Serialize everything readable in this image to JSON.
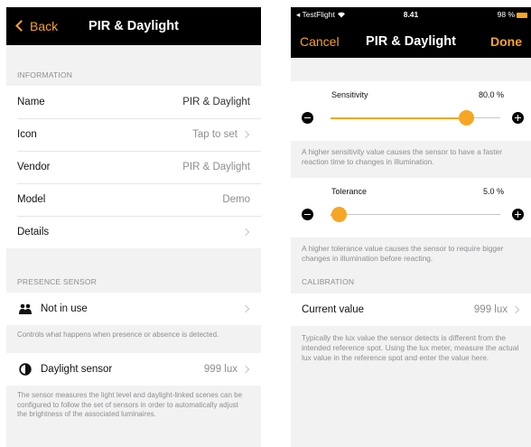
{
  "left": {
    "nav": {
      "back_label": "Back",
      "title": "PIR & Daylight"
    },
    "information": {
      "header": "INFORMATION",
      "rows": [
        {
          "label": "Name",
          "value": "PIR & Daylight"
        },
        {
          "label": "Icon",
          "value": "Tap to set"
        },
        {
          "label": "Vendor",
          "value": "PIR & Daylight"
        },
        {
          "label": "Model",
          "value": "Demo"
        },
        {
          "label": "Details",
          "value": ""
        }
      ]
    },
    "presence": {
      "header": "PRESENCE SENSOR",
      "row_label": "Not in use",
      "footer": "Controls what happens when presence or absence is detected."
    },
    "daylight": {
      "row_label": "Daylight sensor",
      "row_value": "999 lux",
      "footer": "The sensor measures the light level and daylight-linked scenes can be configured to follow the set of sensors in order to automatically adjust the brightness of the associated luminaires."
    }
  },
  "right": {
    "status": {
      "carrier": "◂ TestFlight",
      "time": "8.41",
      "battery": "98 %"
    },
    "nav": {
      "cancel_label": "Cancel",
      "title": "PIR & Daylight",
      "done_label": "Done"
    },
    "sensitivity": {
      "label": "Sensitivity",
      "value_text": "80.0 %",
      "level": 0.8,
      "footer": "A higher sensitivity value causes the sensor to have a faster reaction time to changes in illumination."
    },
    "tolerance": {
      "label": "Tolerance",
      "value_text": "5.0 %",
      "level": 0.05,
      "footer": "A higher tolerance value causes the sensor to require bigger changes in illumination before reacting."
    },
    "calibration": {
      "header": "CALIBRATION",
      "row_label": "Current value",
      "row_value": "999 lux",
      "footer": "Typically the lux value the sensor detects is different from the intended reference spot. Using the lux meter, measure the actual lux value in the reference spot and enter the value here."
    }
  },
  "colors": {
    "accent": "#f5a623",
    "navbar": "#000000",
    "background": "#f2f2f2"
  },
  "icons": [
    "wifi-icon",
    "battery-icon",
    "back-chevron-icon",
    "chevron-right-icon",
    "people-icon",
    "daylight-icon",
    "minus-icon",
    "plus-icon"
  ]
}
